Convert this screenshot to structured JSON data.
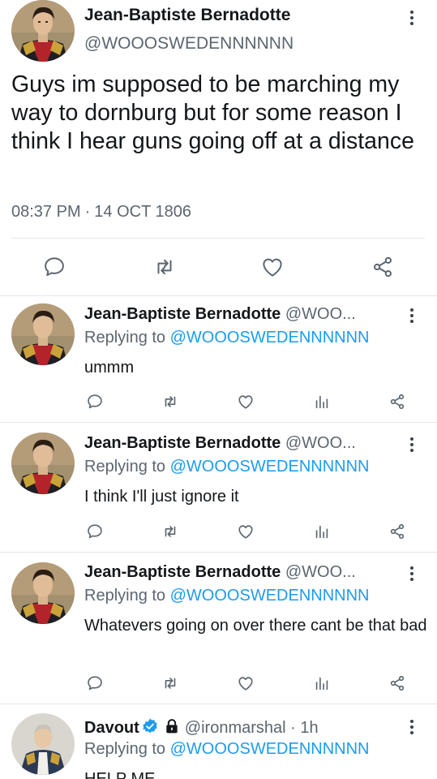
{
  "main_tweet": {
    "name": "Jean-Baptiste Bernadotte",
    "handle": "@WOOOSWEDENNNNNN",
    "text": "Guys im supposed to be marching my way to dornburg but for some reason I think I hear guns going off at a distance",
    "time": "08:37 PM",
    "separator": "·",
    "date": "14 OCT 1806",
    "actions": [
      "reply-icon",
      "retweet-icon",
      "like-icon",
      "share-icon"
    ]
  },
  "replies": [
    {
      "name": "Jean-Baptiste Bernadotte",
      "handle": "@WOO...",
      "replying_prefix": "Replying to",
      "replying_to": "@WOOOSWEDENNNNNN",
      "text": "ummm"
    },
    {
      "name": "Jean-Baptiste Bernadotte",
      "handle": "@WOO...",
      "replying_prefix": "Replying to",
      "replying_to": "@WOOOSWEDENNNNNN",
      "text": "I think I'll just ignore it"
    },
    {
      "name": "Jean-Baptiste Bernadotte",
      "handle": "@WOO...",
      "replying_prefix": "Replying to",
      "replying_to": "@WOOOSWEDENNNNNN",
      "text": "Whatevers going on over there cant be that bad"
    },
    {
      "name": "Davout",
      "handle": "@ironmarshal · 1h",
      "replying_prefix": "Replying to",
      "replying_to": "@WOOOSWEDENNNNNN",
      "text": "HELP ME",
      "verified": true,
      "protected": true
    }
  ],
  "reply_actions": [
    "reply-icon",
    "retweet-icon",
    "like-icon",
    "analytics-icon",
    "share-icon"
  ],
  "colors": {
    "text": "#14171a",
    "secondary": "#5b6670",
    "accent": "#1d9bf0",
    "divider": "#e1e8ed"
  }
}
